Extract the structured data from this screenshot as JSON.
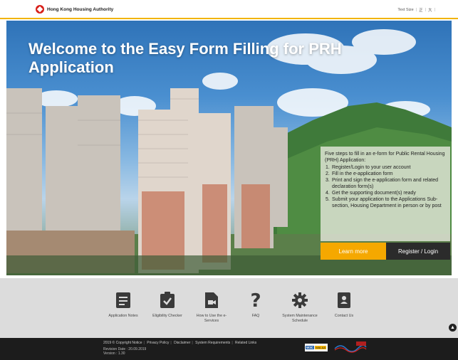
{
  "header": {
    "logo_text": "Hong Kong Housing Authority",
    "text_size_label": "Text Size",
    "text_size_options": [
      "正",
      "大"
    ]
  },
  "hero": {
    "title": "Welcome to the Easy Form Filling for PRH Application",
    "steps_intro": "Five steps to fill in an e-form for Public Rental Housing (PRH) Application:",
    "steps": [
      "Register/Login to your user account",
      "Fill in the e-application form",
      "Print and sign the e-application form and related declaration form(s)",
      "Get the supporting document(s) ready",
      "Submit your application to the Applications Sub-section, Housing Department in person or by post"
    ],
    "learn_more_label": "Learn more",
    "register_label": "Register / Login"
  },
  "iconbar": {
    "items": [
      {
        "label": "Application Notes",
        "icon": "notes-icon"
      },
      {
        "label": "Eligibility Checker",
        "icon": "checklist-icon"
      },
      {
        "label": "How to Use the e-Services",
        "icon": "video-icon"
      },
      {
        "label": "FAQ",
        "icon": "question-icon"
      },
      {
        "label": "System Maintenance Schedule",
        "icon": "gear-icon"
      },
      {
        "label": "Contact Us",
        "icon": "contact-icon"
      }
    ]
  },
  "footer": {
    "copyright": "2019 © Copyright Notice",
    "links": [
      "Privacy Policy",
      "Disclaimer",
      "System Requirements",
      "Related Links"
    ],
    "revision": "Revision Date : 20.09.2019",
    "version": "Version : 1.30"
  },
  "colors": {
    "accent_yellow": "#f5a800",
    "dark_button": "#2b2b2b",
    "logo_red": "#d8201a",
    "icon_dark": "#3a3a3a"
  }
}
